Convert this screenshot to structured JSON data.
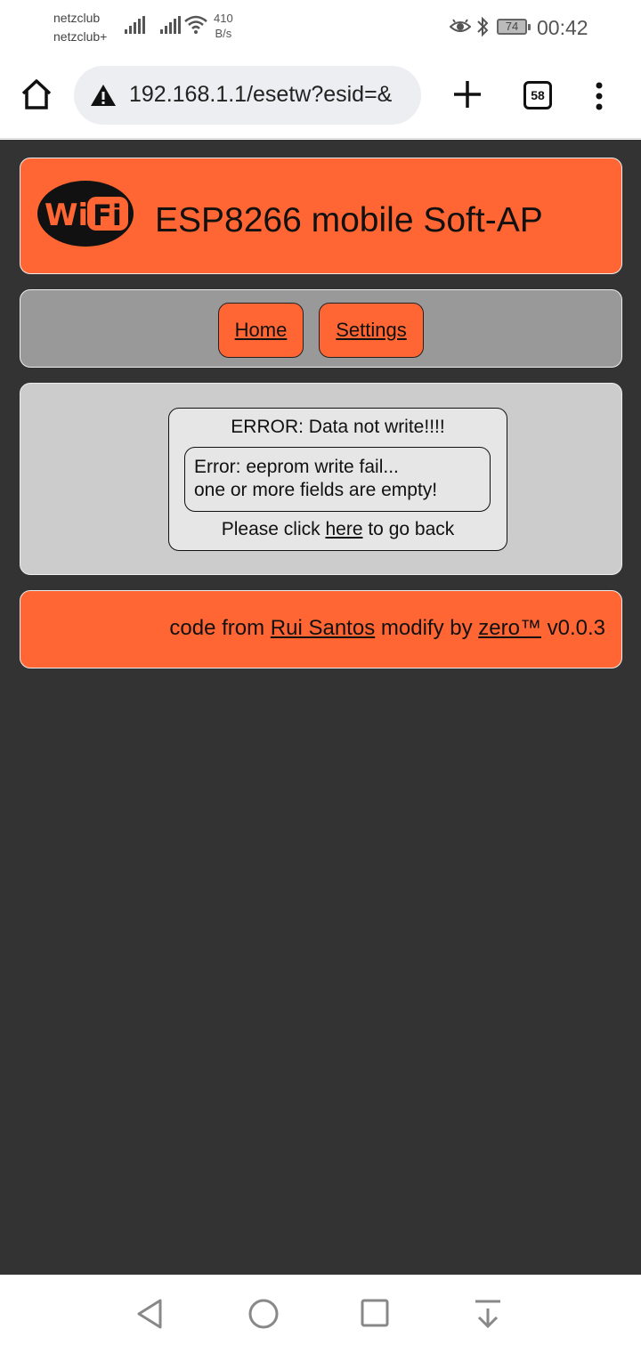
{
  "status_bar": {
    "carrier1": "netzclub",
    "carrier2": "netzclub+",
    "net_speed_value": "410",
    "net_speed_unit": "B/s",
    "battery": "74",
    "time": "00:42"
  },
  "browser": {
    "url": "192.168.1.1/esetw?esid=&",
    "tab_count": "58"
  },
  "header": {
    "logo_text_wi": "Wi",
    "logo_text_fi": "Fi",
    "title": "ESP8266 mobile Soft-AP"
  },
  "nav": {
    "home_label": "Home",
    "settings_label": "Settings"
  },
  "error": {
    "title": "ERROR: Data not write!!!!",
    "detail_line1": "Error: eeprom write fail...",
    "detail_line2": "one or more fields are empty!",
    "back_prefix": "Please click",
    "back_link": "here",
    "back_suffix": "to go back"
  },
  "footer": {
    "prefix": "code from",
    "author_link": "Rui Santos",
    "middle": "modify by",
    "modifier_link": "zero™",
    "version": "v0.0.3"
  },
  "colors": {
    "accent": "#ff6633",
    "page_bg": "#333333",
    "nav_bg": "#999999",
    "content_bg": "#cccccc"
  }
}
